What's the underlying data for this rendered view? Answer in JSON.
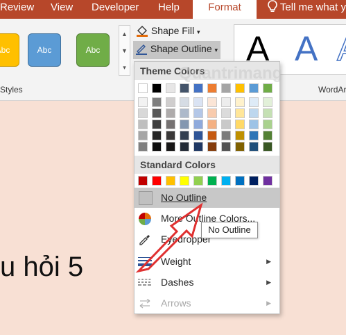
{
  "tabs": {
    "review": "Review",
    "view": "View",
    "developer": "Developer",
    "help": "Help",
    "format": "Format",
    "tell_me": "Tell me what y"
  },
  "shape_styles": {
    "swatches": [
      {
        "label": "Abc",
        "color": "#ffc000"
      },
      {
        "label": "Abc",
        "color": "#5b9bd5"
      },
      {
        "label": "Abc",
        "color": "#70ad47"
      }
    ],
    "group_label": "Styles"
  },
  "shape_fill_label": "Shape Fill",
  "shape_outline_label": "Shape Outline",
  "wordart": {
    "letters": [
      "A",
      "A",
      "A"
    ],
    "group_label": "WordArt"
  },
  "watermark": "Quantrimang",
  "slide_text": "u hỏi 5",
  "menu": {
    "theme_colors_header": "Theme Colors",
    "theme_top_row": [
      "#ffffff",
      "#000000",
      "#e7e6e6",
      "#44546a",
      "#4472c4",
      "#ed7d31",
      "#a5a5a5",
      "#ffc000",
      "#5b9bd5",
      "#70ad47"
    ],
    "theme_shades": [
      [
        "#f2f2f2",
        "#7f7f7f",
        "#d0cece",
        "#d6dce4",
        "#dae3f3",
        "#fbe5d6",
        "#ededed",
        "#fff2cc",
        "#deebf7",
        "#e2f0d9"
      ],
      [
        "#d8d8d8",
        "#595959",
        "#aeabab",
        "#adb9ca",
        "#b4c7e7",
        "#f8cbad",
        "#dbdbdb",
        "#ffe699",
        "#bdd7ee",
        "#c5e0b4"
      ],
      [
        "#bfbfbf",
        "#3f3f3f",
        "#757171",
        "#8497b0",
        "#8faadc",
        "#f4b183",
        "#c9c9c9",
        "#ffd966",
        "#9dc3e6",
        "#a9d18e"
      ],
      [
        "#a5a5a5",
        "#262626",
        "#3a3838",
        "#333f50",
        "#2f5597",
        "#c55a11",
        "#7b7b7b",
        "#bf9000",
        "#2e75b6",
        "#538135"
      ],
      [
        "#7f7f7f",
        "#0d0d0d",
        "#171616",
        "#222a35",
        "#1f3864",
        "#843c0c",
        "#525252",
        "#7f6000",
        "#1f4e79",
        "#385723"
      ]
    ],
    "standard_colors_header": "Standard Colors",
    "standard_colors": [
      "#c00000",
      "#ff0000",
      "#ffc000",
      "#ffff00",
      "#92d050",
      "#00b050",
      "#00b0f0",
      "#0070c0",
      "#002060",
      "#7030a0"
    ],
    "items": {
      "no_outline": "No Outline",
      "more_outline_colors": "More Outline Colors...",
      "eyedropper": "Eyedropper",
      "weight": "Weight",
      "dashes": "Dashes",
      "arrows": "Arrows"
    },
    "annotation_color": "#e03030"
  },
  "tooltip": "No Outline"
}
